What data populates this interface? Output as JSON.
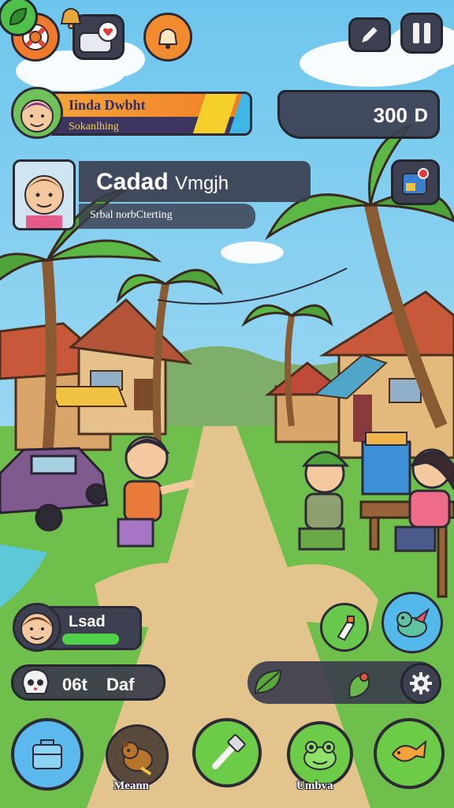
{
  "top_bar": {
    "lifebuoy_icon": "lifebuoy-icon",
    "mail_icon": "mail-heart-icon",
    "alarm_icon": "alarm-bell-icon",
    "resources": {
      "leaf_icon": "leaf-icon",
      "bell_icon": "gold-bell-icon"
    },
    "edit_icon": "pencil-icon",
    "pause_icon": "pause-icon"
  },
  "player": {
    "name": "Iinda Dwbht",
    "subtitle": "Sokanlhing",
    "coins": "300",
    "coin_label": "D"
  },
  "character_card": {
    "title_bold": "Cadad",
    "title_rest": "Vmgjh",
    "subtitle": "Srbal norbCterting"
  },
  "minimap_icon": "map-pin-icon",
  "lead": {
    "label": "Lsad",
    "progress": 0.75
  },
  "skull_counter": {
    "value": "06t",
    "label": "Daf"
  },
  "bottom_bar": {
    "bag_icon": "backpack-icon",
    "bear_label": "Meann",
    "hammer_icon": "hammer-icon",
    "frog_label": "Umbva",
    "fish_icon": "fish-icon"
  },
  "colors": {
    "hud_dark": "#3c4050",
    "accent_orange": "#f07a2c",
    "accent_green": "#6ccc48",
    "accent_blue": "#5bb9ee",
    "progress_green": "#52d24a"
  }
}
